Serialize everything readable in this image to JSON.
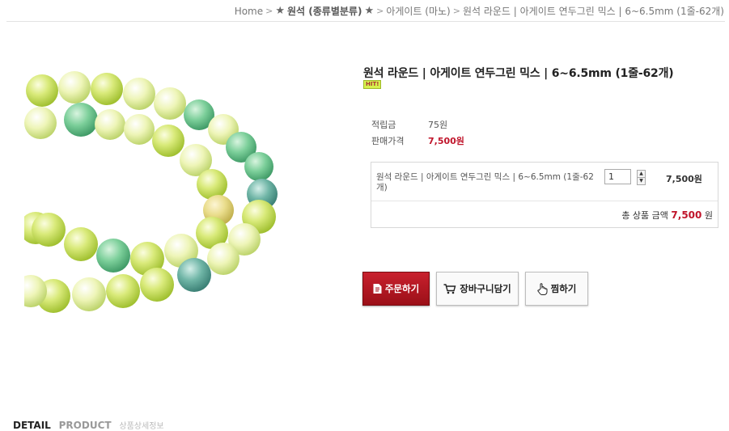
{
  "breadcrumb": {
    "home": "Home",
    "category": "원석 (종류별분류)",
    "subcategory": "아게이트 (마노)",
    "current": "원석 라운드 | 아게이트 연두그린 믹스 | 6~6.5mm (1줄-62개)"
  },
  "product": {
    "title": "원석 라운드 | 아게이트 연두그린 믹스 | 6~6.5mm (1줄-62개)",
    "badge": "HIT!",
    "points_label": "적립금",
    "points_value": "75원",
    "price_label": "판매가격",
    "price_value": "7,500원"
  },
  "option": {
    "name": "원석 라운드 | 아게이트 연두그린 믹스 | 6~6.5mm (1줄-62개)",
    "quantity": "1",
    "price": "7,500원",
    "total_label": "총 상품 금액",
    "total_value": "7,500",
    "total_unit": "원"
  },
  "buttons": {
    "order": "주문하기",
    "cart": "장바구니담기",
    "wish": "찜하기"
  },
  "tabs": {
    "detail": "DETAIL",
    "product": "PRODUCT",
    "sub": "상품상세정보"
  },
  "colors": {
    "accent_red": "#c0152b",
    "order_button": "#b0161f"
  }
}
